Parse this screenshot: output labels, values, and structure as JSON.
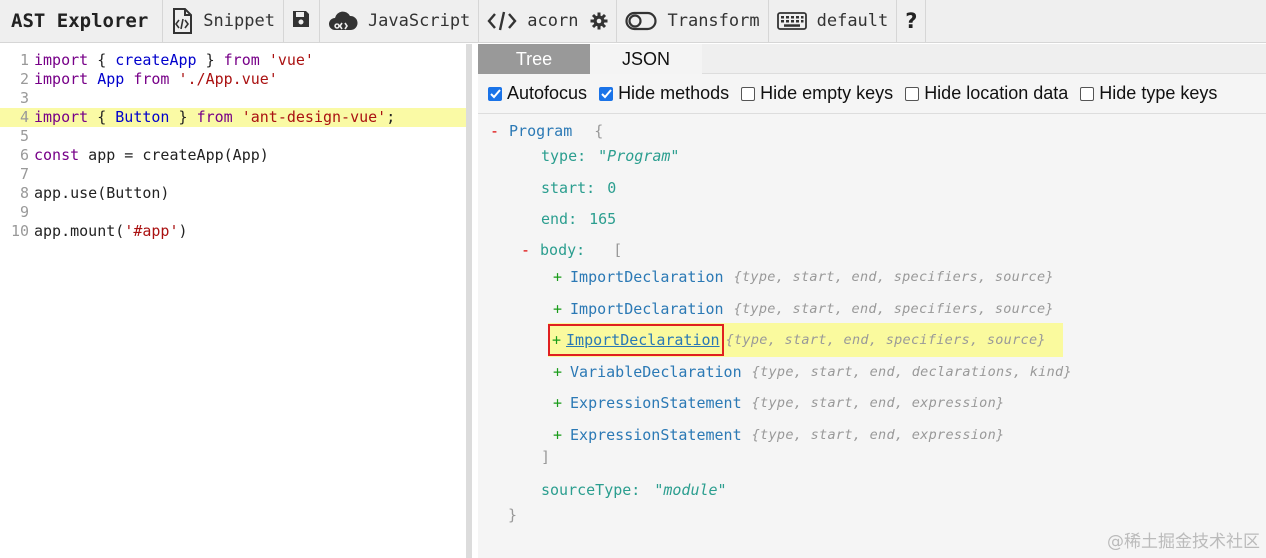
{
  "toolbar": {
    "title": "AST Explorer",
    "snippet_label": "Snippet",
    "language_label": "JavaScript",
    "parser_label": "acorn",
    "transform_label": "Transform",
    "keymap_label": "default",
    "help_label": "?"
  },
  "editor": {
    "lines": [
      {
        "num": "1",
        "tokens": [
          [
            "kw",
            "import"
          ],
          [
            "",
            " { "
          ],
          [
            "def",
            "createApp"
          ],
          [
            "",
            " } "
          ],
          [
            "kw",
            "from"
          ],
          [
            "",
            " "
          ],
          [
            "str",
            "'vue'"
          ]
        ]
      },
      {
        "num": "2",
        "tokens": [
          [
            "kw",
            "import"
          ],
          [
            "",
            " "
          ],
          [
            "def",
            "App"
          ],
          [
            "",
            " "
          ],
          [
            "kw",
            "from"
          ],
          [
            "",
            " "
          ],
          [
            "str",
            "'./App.vue'"
          ]
        ]
      },
      {
        "num": "3",
        "tokens": []
      },
      {
        "num": "4",
        "tokens": [
          [
            "kw",
            "import"
          ],
          [
            "",
            " { "
          ],
          [
            "def",
            "Button"
          ],
          [
            "",
            " } "
          ],
          [
            "kw",
            "from"
          ],
          [
            "",
            " "
          ],
          [
            "str",
            "'ant-design-vue'"
          ],
          [
            "",
            ";"
          ]
        ],
        "highlight": true
      },
      {
        "num": "5",
        "tokens": []
      },
      {
        "num": "6",
        "tokens": [
          [
            "kw",
            "const"
          ],
          [
            "",
            " app = createApp(App)"
          ]
        ]
      },
      {
        "num": "7",
        "tokens": []
      },
      {
        "num": "8",
        "tokens": [
          [
            "",
            "app.use(Button)"
          ]
        ]
      },
      {
        "num": "9",
        "tokens": []
      },
      {
        "num": "10",
        "tokens": [
          [
            "",
            "app.mount("
          ],
          [
            "str",
            "'#app'"
          ],
          [
            "",
            ")"
          ]
        ]
      }
    ]
  },
  "tabs": {
    "tree": "Tree",
    "json": "JSON"
  },
  "options": {
    "autofocus": {
      "label": "Autofocus",
      "checked": true
    },
    "hide_methods": {
      "label": "Hide methods",
      "checked": true
    },
    "hide_empty_keys": {
      "label": "Hide empty keys",
      "checked": false
    },
    "hide_location_data": {
      "label": "Hide location data",
      "checked": false
    },
    "hide_type_keys": {
      "label": "Hide type keys",
      "checked": false
    }
  },
  "tree": {
    "root_toggle": "-",
    "root_name": "Program",
    "root_open": "{",
    "type_key": "type:",
    "type_val": "\"Program\"",
    "start_key": "start:",
    "start_val": "0",
    "end_key": "end:",
    "end_val": "165",
    "body_toggle": "-",
    "body_key": "body:",
    "body_open": "[",
    "body_items": [
      {
        "toggle": "+",
        "name": "ImportDeclaration",
        "summary": "{type, start, end, specifiers, source}"
      },
      {
        "toggle": "+",
        "name": "ImportDeclaration",
        "summary": "{type, start, end, specifiers, source}"
      },
      {
        "toggle": "+",
        "name": "ImportDeclaration",
        "summary": "{type, start, end, specifiers, source}",
        "selected": true
      },
      {
        "toggle": "+",
        "name": "VariableDeclaration",
        "summary": "{type, start, end, declarations, kind}"
      },
      {
        "toggle": "+",
        "name": "ExpressionStatement",
        "summary": "{type, start, end, expression}"
      },
      {
        "toggle": "+",
        "name": "ExpressionStatement",
        "summary": "{type, start, end, expression}"
      }
    ],
    "body_close": "]",
    "sourcetype_key": "sourceType:",
    "sourcetype_val": "\"module\"",
    "root_close": "}"
  },
  "watermark": "@稀土掘金技术社区",
  "icons": {
    "snippet": "code-file-icon",
    "save": "save-icon",
    "language": "cloud-icon",
    "parser": "code-brackets-icon",
    "settings": "gear-icon",
    "transform": "toggle-icon",
    "keymap": "keyboard-icon",
    "help": "help-icon"
  }
}
